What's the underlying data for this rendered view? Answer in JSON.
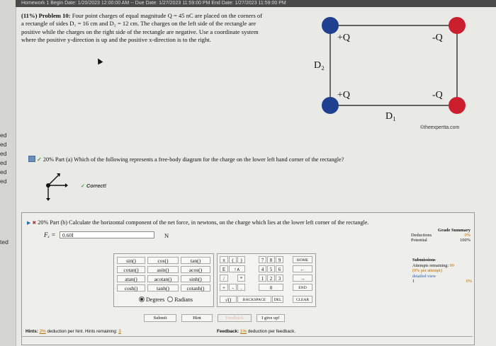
{
  "topbar_text": "Homework 1 Begin Date: 1/20/2023 12:00:00 AM -- Due Date: 1/27/2023 11:59:00 PM End Date: 1/27/2023 11:59:00 PM",
  "left_strip": [
    "ed",
    "ed",
    "ed",
    "ed",
    "ed",
    "ed",
    "ted"
  ],
  "problem": {
    "header": "(11%) Problem 10:",
    "lines": [
      "Four point charges of equal magnitude Q = 45 nC are placed on the corners of",
      "a rectangle of sides D₁ = 16 cm and D₂ = 12 cm. The charges on the left side of the rectangle are",
      "positive while the charges on the right side of the rectangle are negative. Use a coordinate system",
      "where the positive y-direction is up and the positive x-direction is to the right."
    ]
  },
  "diagram": {
    "label_pos_top": "+Q",
    "label_neg_top": "-Q",
    "label_pos_bottom": "+Q",
    "label_neg_bottom": "-Q",
    "label_d2": "D₂",
    "label_d1": "D₁",
    "credit": "©theexpertta.com",
    "positive_color": "#1f3f8f",
    "negative_color": "#cc1f2e"
  },
  "part_a": {
    "text": "20% Part (a) Which of the following represents a free-body diagram for the charge on the lower left hand corner of the rectangle?",
    "status": "Correct!"
  },
  "part_b": {
    "text": "20% Part (b) Calculate the horizontal component of the net force, in newtons, on the charge which lies at the lower left corner of the rectangle.",
    "input_label": "Fₓ =",
    "input_value": "0.60I",
    "unit": "N"
  },
  "grade_summary": {
    "title": "Grade Summary",
    "deductions_label": "Deductions",
    "deductions_value": "0%",
    "potential_label": "Potential",
    "potential_value": "100%"
  },
  "submissions": {
    "title": "Submissions",
    "attempts_label": "Attempts remaining:",
    "attempts_value": "99",
    "per_attempt": "(0% per attempt)",
    "detailed_view": "detailed view",
    "row_index": "1",
    "row_value": "0%"
  },
  "functions": [
    "sin()",
    "cos()",
    "tan()",
    "cotan()",
    "asin()",
    "acos()",
    "atan()",
    "acotan()",
    "sinh()",
    "cosh()",
    "tanh()",
    "cotanh()"
  ],
  "angle_mode": {
    "degrees": "Degrees",
    "radians": "Radians",
    "selected": "Degrees"
  },
  "keypad": {
    "pi": "π",
    "lparen": "(",
    "rparen": ")",
    "e": "E",
    "up": "↑∧",
    "slash": "/",
    "star": "*",
    "plus": "+",
    "minus": "-",
    "sqrt": "√()",
    "backspace": "BACKSPACE",
    "del": "DEL",
    "clear": "CLEAR",
    "home": "HOME",
    "end": "END",
    "left": "←",
    "right": "→",
    "dot": ".",
    "d7": "7",
    "d8": "8",
    "d9": "9",
    "d4": "4",
    "d5": "5",
    "d6": "6",
    "d1": "1",
    "d2": "2",
    "d3": "3",
    "d0": "0"
  },
  "actions": {
    "submit": "Submit",
    "hint": "Hint",
    "feedback": "Feedback",
    "give_up": "I give up!"
  },
  "hints_line": {
    "label": "Hints:",
    "pct": "2%",
    "mid": "deduction per hint. Hints remaining:",
    "remaining": "3"
  },
  "feedback_line": {
    "label": "Feedback:",
    "pct": "1%",
    "mid": "deduction per feedback."
  }
}
